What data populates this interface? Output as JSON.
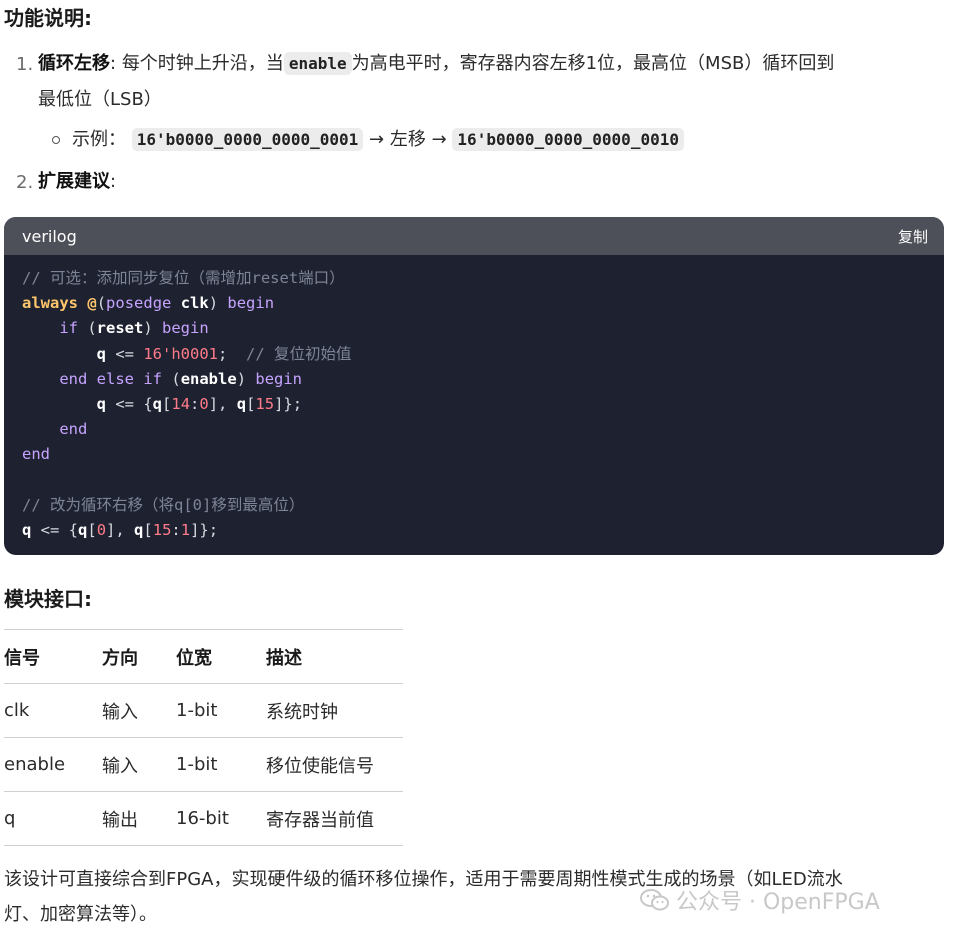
{
  "section_title": "功能说明:",
  "items": [
    {
      "num": "1.",
      "title": "循环左移",
      "sep": ":",
      "text_a": "每个时钟上升沿，当",
      "code": "enable",
      "text_b": "为高电平时，寄存器内容左移1位，最高位（MSB）循环回到",
      "text_c": "最低位（LSB）",
      "example_label": "示例：",
      "example_from": "16'b0000_0000_0000_0001",
      "arrow1": "→",
      "example_op": "左移",
      "arrow2": "→",
      "example_to": "16'b0000_0000_0000_0010"
    },
    {
      "num": "2.",
      "title": "扩展建议",
      "sep": ":"
    }
  ],
  "codeblock": {
    "language": "verilog",
    "copy_label": "复制",
    "lines": [
      "// 可选：添加同步复位（需增加reset端口）",
      "always @(posedge clk) begin",
      "    if (reset) begin",
      "        q <= 16'h0001;  // 复位初始值",
      "    end else if (enable) begin",
      "        q <= {q[14:0], q[15]};",
      "    end",
      "end",
      "",
      "// 改为循环右移（将q[0]移到最高位）",
      "q <= {q[0], q[15:1]};"
    ]
  },
  "interface_title": "模块接口:",
  "table": {
    "headers": [
      "信号",
      "方向",
      "位宽",
      "描述"
    ],
    "rows": [
      [
        "clk",
        "输入",
        "1-bit",
        "系统时钟"
      ],
      [
        "enable",
        "输入",
        "1-bit",
        "移位使能信号"
      ],
      [
        "q",
        "输出",
        "16-bit",
        "寄存器当前值"
      ]
    ]
  },
  "footer_line1": "该设计可直接综合到FPGA，实现硬件级的循环移位操作，适用于需要周期性模式生成的场景（如LED流水",
  "footer_line2": "灯、加密算法等）。",
  "watermark": "公众号 · OpenFPGA"
}
